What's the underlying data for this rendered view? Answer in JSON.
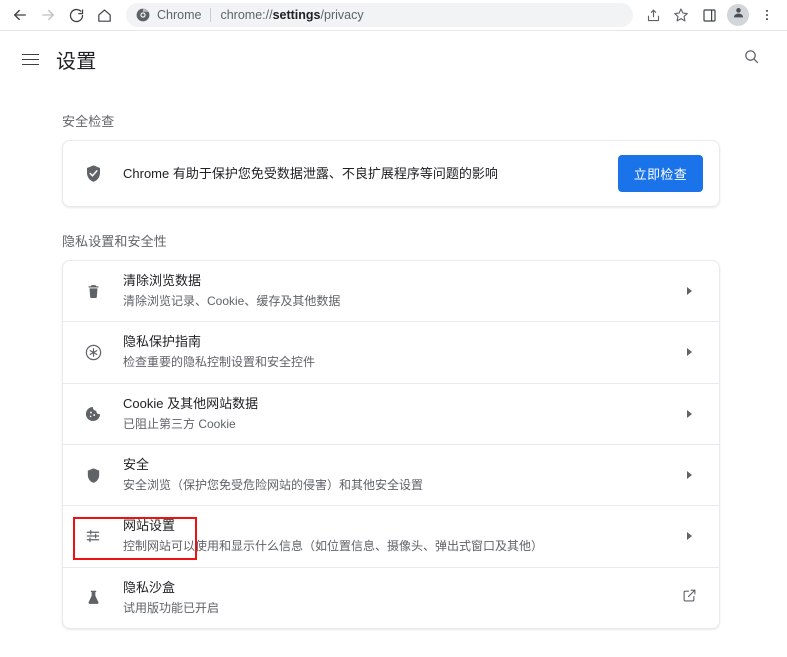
{
  "browser": {
    "nav": {
      "back_icon": "arrow-left-icon",
      "forward_icon": "arrow-right-icon",
      "reload_icon": "reload-icon",
      "home_icon": "home-icon"
    },
    "omnibox": {
      "site_icon": "chrome-logo-icon",
      "site_label": "Chrome",
      "url_prefix": "chrome://",
      "url_bold": "settings",
      "url_suffix": "/privacy",
      "full_url": "chrome://settings/privacy"
    },
    "actions": {
      "share_icon": "share-icon",
      "bookmark_icon": "star-icon",
      "side_panel_icon": "side-panel-icon",
      "profile_icon": "profile-avatar-icon",
      "menu_icon": "three-dot-menu-icon"
    }
  },
  "header": {
    "menu_icon": "hamburger-menu-icon",
    "title": "设置",
    "search_icon": "search-icon"
  },
  "safety_check": {
    "section_title": "安全检查",
    "icon": "shield-check-icon",
    "description": "Chrome 有助于保护您免受数据泄露、不良扩展程序等问题的影响",
    "button_label": "立即检查",
    "button_color": "#1a73e8"
  },
  "privacy": {
    "section_title": "隐私设置和安全性",
    "items": [
      {
        "icon": "trash-icon",
        "title": "清除浏览数据",
        "subtitle": "清除浏览记录、Cookie、缓存及其他数据",
        "end_icon": "chevron-right-icon",
        "highlighted": false
      },
      {
        "icon": "privacy-guide-icon",
        "title": "隐私保护指南",
        "subtitle": "检查重要的隐私控制设置和安全控件",
        "end_icon": "chevron-right-icon",
        "highlighted": false
      },
      {
        "icon": "cookie-icon",
        "title": "Cookie 及其他网站数据",
        "subtitle": "已阻止第三方 Cookie",
        "end_icon": "chevron-right-icon",
        "highlighted": false
      },
      {
        "icon": "shield-icon",
        "title": "安全",
        "subtitle": "安全浏览（保护您免受危险网站的侵害）和其他安全设置",
        "end_icon": "chevron-right-icon",
        "highlighted": false
      },
      {
        "icon": "tune-sliders-icon",
        "title": "网站设置",
        "subtitle": "控制网站可以使用和显示什么信息（如位置信息、摄像头、弹出式窗口及其他）",
        "end_icon": "chevron-right-icon",
        "highlighted": true
      },
      {
        "icon": "flask-icon",
        "title": "隐私沙盒",
        "subtitle": "试用版功能已开启",
        "end_icon": "external-link-icon",
        "highlighted": false
      }
    ]
  },
  "annotation": {
    "color": "#ee1111",
    "target": "网站设置"
  }
}
